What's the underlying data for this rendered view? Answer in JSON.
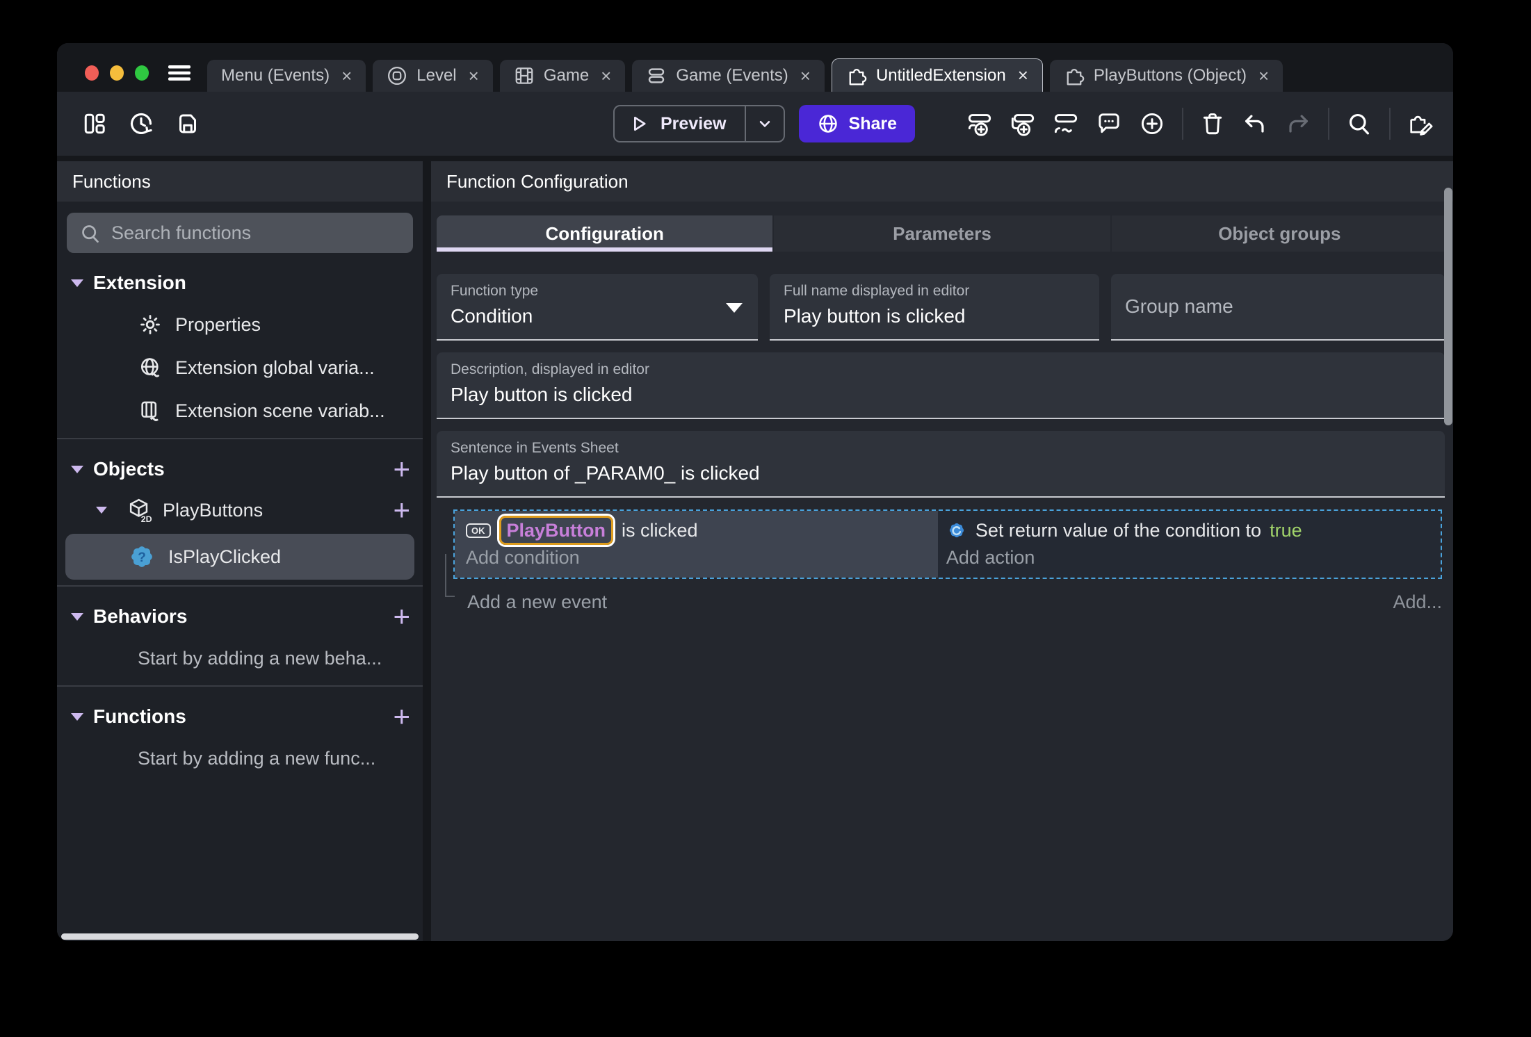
{
  "tabbar": {
    "close_glyph": "×",
    "tabs": [
      {
        "label": "Menu (Events)"
      },
      {
        "label": "Level"
      },
      {
        "label": "Game"
      },
      {
        "label": "Game (Events)"
      },
      {
        "label": "UntitledExtension"
      },
      {
        "label": "PlayButtons (Object)"
      }
    ]
  },
  "toolbar": {
    "preview_label": "Preview",
    "share_label": "Share"
  },
  "sidebar": {
    "title": "Functions",
    "search_placeholder": "Search functions",
    "plus_glyph": "+",
    "extension": {
      "label": "Extension",
      "items": [
        {
          "label": "Properties"
        },
        {
          "label": "Extension global varia..."
        },
        {
          "label": "Extension scene variab..."
        }
      ]
    },
    "objects": {
      "label": "Objects",
      "object": {
        "label": "PlayButtons",
        "badge": "2D"
      },
      "function": {
        "label": "IsPlayClicked"
      }
    },
    "behaviors": {
      "label": "Behaviors",
      "hint": "Start by adding a new beha..."
    },
    "functions": {
      "label": "Functions",
      "hint": "Start by adding a new func..."
    }
  },
  "main": {
    "title": "Function Configuration",
    "tabs": [
      {
        "label": "Configuration"
      },
      {
        "label": "Parameters"
      },
      {
        "label": "Object groups"
      }
    ],
    "fields": {
      "function_type": {
        "label": "Function type",
        "value": "Condition"
      },
      "full_name": {
        "label": "Full name displayed in editor",
        "value": "Play button is clicked"
      },
      "group_name": {
        "placeholder": "Group name"
      },
      "description": {
        "label": "Description, displayed in editor",
        "value": "Play button is clicked"
      },
      "sentence": {
        "label": "Sentence in Events Sheet",
        "value": "Play button of _PARAM0_ is clicked"
      }
    },
    "event": {
      "condition": {
        "object_icon_text": "OK",
        "object_name": "PlayButton",
        "suffix": "is clicked",
        "placeholder": "Add condition"
      },
      "action": {
        "prefix": "Set return value of the condition to",
        "value": "true",
        "placeholder": "Add action"
      }
    },
    "events_footer": {
      "add_event": "Add a new event",
      "add_button": "Add..."
    }
  },
  "colors": {
    "accent_purple": "#4a27d6",
    "object_chip_text": "#c77fd9",
    "object_chip_border": "#dd9c1e",
    "boolean_true_green": "#a1d36a",
    "event_selection_blue": "#4aa3dc"
  }
}
